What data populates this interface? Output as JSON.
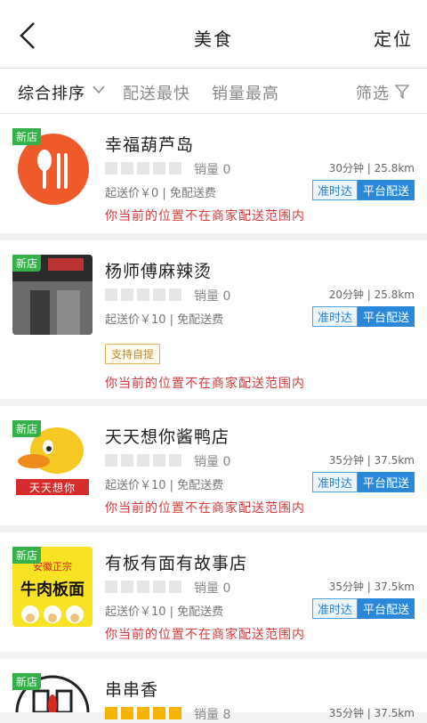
{
  "header": {
    "title": "美食",
    "locate": "定位"
  },
  "filters": {
    "comprehensive": "综合排序",
    "fastest": "配送最快",
    "sales": "销量最高",
    "screen": "筛选"
  },
  "new_badge": "新店",
  "restaurants": [
    {
      "name": "幸福葫芦岛",
      "rating": 0,
      "sales": "销量 0",
      "time": "30分钟",
      "distance": "25.8km",
      "fee": "起送价￥0 | 免配送费",
      "tag1": "准时达",
      "tag2": "平台配送",
      "warn": "你当前的位置不在商家配送范围内"
    },
    {
      "name": "杨师傅麻辣烫",
      "rating": 0,
      "sales": "销量 0",
      "time": "20分钟",
      "distance": "25.8km",
      "fee": "起送价￥10 | 免配送费",
      "tag1": "准时达",
      "tag2": "平台配送",
      "selfpick": "支持自提",
      "warn": "你当前的位置不在商家配送范围内"
    },
    {
      "name": "天天想你酱鸭店",
      "rating": 0,
      "sales": "销量 0",
      "time": "35分钟",
      "distance": "37.5km",
      "fee": "起送价￥10 | 免配送费",
      "tag1": "准时达",
      "tag2": "平台配送",
      "warn": "你当前的位置不在商家配送范围内",
      "logo_text": "天天想你"
    },
    {
      "name": "有板有面有故事店",
      "rating": 0,
      "sales": "销量 0",
      "time": "35分钟",
      "distance": "37.5km",
      "fee": "起送价￥10 | 免配送费",
      "tag1": "准时达",
      "tag2": "平台配送",
      "warn": "你当前的位置不在商家配送范围内",
      "logo_top": "安徽正宗",
      "logo_main": "牛肉板面"
    },
    {
      "name": "串串香",
      "rating": 5,
      "sales": "销量 8",
      "time": "35分钟",
      "distance": "37.5km"
    }
  ],
  "colors": {
    "accent_blue": "#2b88d9",
    "warn_red": "#d43b3b",
    "new_green": "#36b14a",
    "star_gold": "#f5b400"
  }
}
